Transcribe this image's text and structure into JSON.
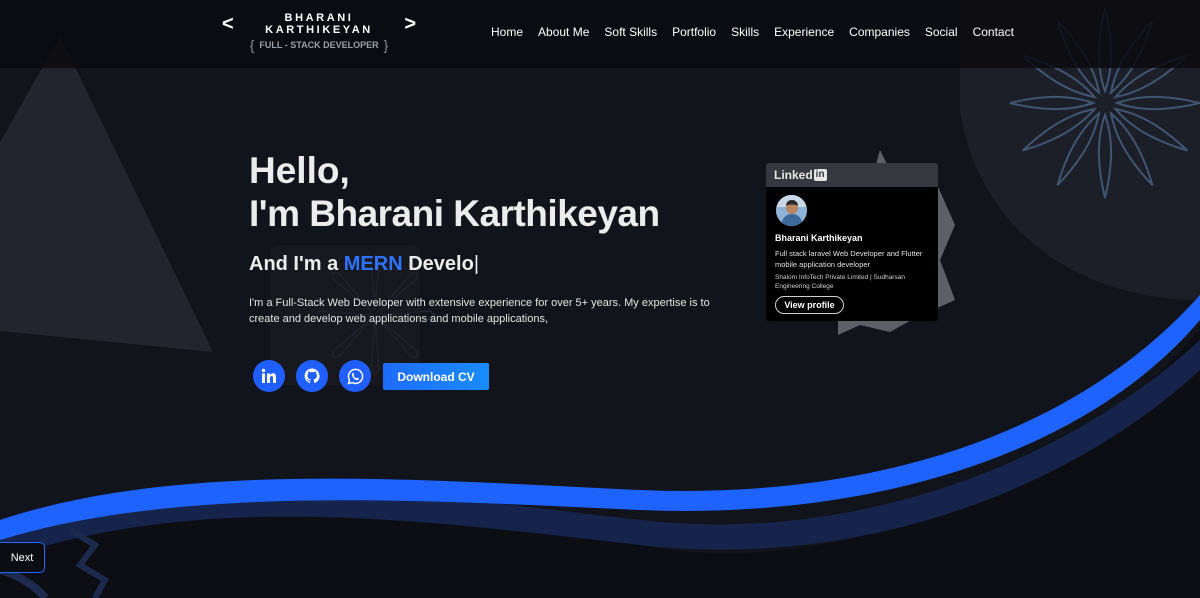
{
  "brand": {
    "open_bracket": "<",
    "name": "BHARANI KARTHIKEYAN",
    "close_bracket": ">",
    "open_brace": "{",
    "tagline": "FULL - STACK DEVELOPER",
    "close_brace": "}"
  },
  "nav": {
    "items": [
      {
        "label": "Home"
      },
      {
        "label": "About Me"
      },
      {
        "label": "Soft Skills"
      },
      {
        "label": "Portfolio"
      },
      {
        "label": "Skills"
      },
      {
        "label": "Experience"
      },
      {
        "label": "Companies"
      },
      {
        "label": "Social"
      },
      {
        "label": "Contact"
      }
    ]
  },
  "hero": {
    "greeting": "Hello,",
    "name": "I'm Bharani Karthikeyan",
    "role_prefix": "And I'm a ",
    "role_highlight": "MERN",
    "role_suffix": " Develo",
    "caret": "|",
    "bio": "I'm a Full-Stack Web Developer with extensive experience for over 5+ years. My expertise is to create and develop web applications and mobile applications,",
    "download_label": "Download CV"
  },
  "social_icons": [
    "linkedin-icon",
    "github-icon",
    "whatsapp-icon"
  ],
  "linkedin_card": {
    "brand": "Linked",
    "brand_badge": "in",
    "name": "Bharani Karthikeyan",
    "headline": "Full stack laravel Web Developer and Flutter mobile application developer",
    "org": "Shalom InfoTech Private Limited | Sudharsan Engineering College",
    "button_label": "View profile"
  },
  "pager": {
    "next_label": "Next"
  },
  "colors": {
    "background": "#12141b",
    "accent": "#1f5fff",
    "highlight": "#2e73ff",
    "nav_bg": "#0a0b0f"
  }
}
